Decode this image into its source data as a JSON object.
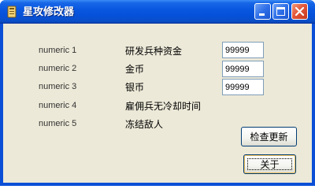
{
  "window": {
    "title": "星攻修改器",
    "controls": {
      "minimize": "minimize-icon",
      "maximize": "maximize-icon",
      "close": "close-icon"
    }
  },
  "rows": [
    {
      "numeric": "numeric 1",
      "label": "研发兵种资金",
      "value": "99999"
    },
    {
      "numeric": "numeric 2",
      "label": "金币",
      "value": "99999"
    },
    {
      "numeric": "numeric 3",
      "label": "银币",
      "value": "99999"
    },
    {
      "numeric": "numeric 4",
      "label": "雇佣兵无冷却时间"
    },
    {
      "numeric": "numeric 5",
      "label": "冻结敌人"
    }
  ],
  "buttons": {
    "check_update": "检查更新",
    "about": "关于"
  },
  "colors": {
    "titlebar": "#0a58e0",
    "window_bg": "#ece9d8",
    "close_button": "#e3573a",
    "field_border": "#7f9db9"
  }
}
